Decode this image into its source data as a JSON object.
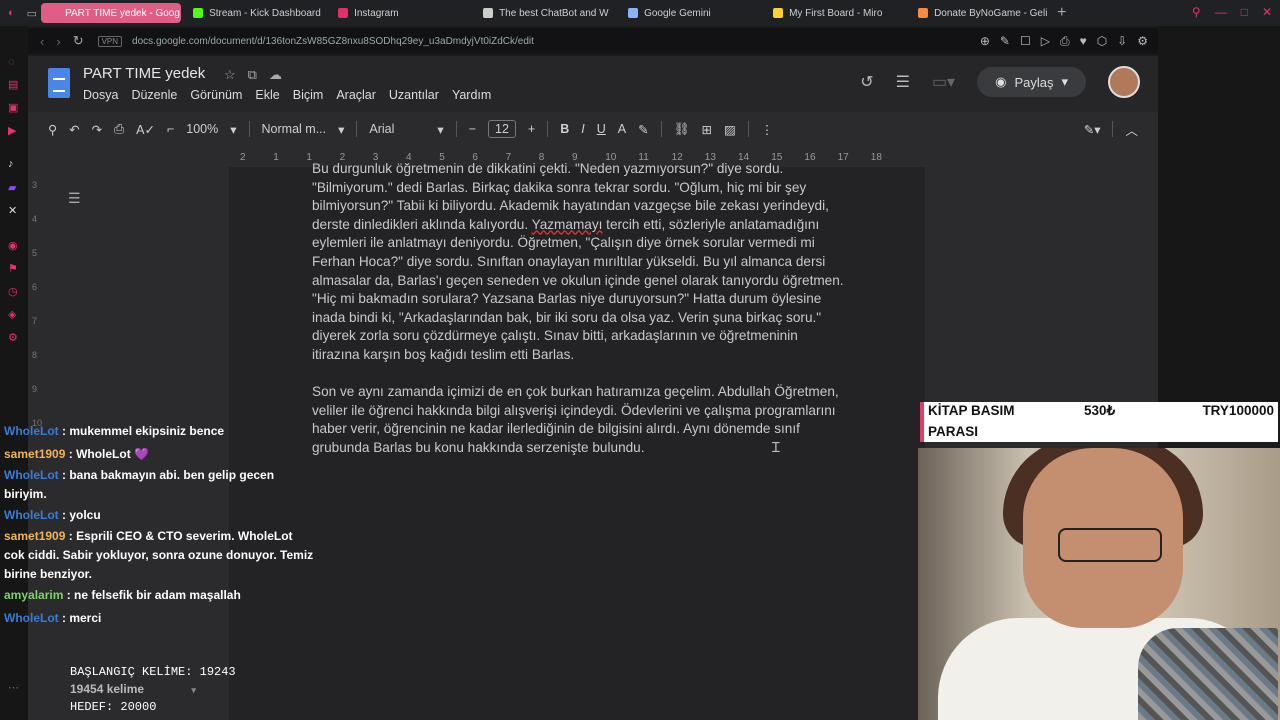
{
  "browser": {
    "tabs": [
      {
        "label": "PART TIME yedek - Goog",
        "color": "#e05d86",
        "active": true
      },
      {
        "label": "Stream - Kick Dashboard",
        "color": "#53fc18",
        "active": false
      },
      {
        "label": "Instagram",
        "color": "#e1306c",
        "active": false
      },
      {
        "label": "The best ChatBot and W",
        "color": "#cccccc",
        "active": false
      },
      {
        "label": "Google Gemini",
        "color": "#8ab4f8",
        "active": false
      },
      {
        "label": "My First Board - Miro",
        "color": "#ffd02f",
        "active": false
      },
      {
        "label": "Donate ByNoGame - Geli",
        "color": "#ff8a3d",
        "active": false
      }
    ],
    "url": "docs.google.com/document/d/136tonZsW85GZ8nxu8SODhq29ey_u3aDmdyjVt0iZdCk/edit"
  },
  "docs": {
    "title": "PART TIME yedek",
    "menus": [
      "Dosya",
      "Düzenle",
      "Görünüm",
      "Ekle",
      "Biçim",
      "Araçlar",
      "Uzantılar",
      "Yardım"
    ],
    "share_label": "Paylaş",
    "zoom": "100%",
    "style": "Normal m...",
    "font": "Arial",
    "font_size": "12",
    "ruler_marks": [
      "2",
      "1",
      "1",
      "2",
      "3",
      "4",
      "5",
      "6",
      "7",
      "8",
      "9",
      "10",
      "11",
      "12",
      "13",
      "14",
      "15",
      "16",
      "17",
      "18"
    ],
    "paragraphs": [
      "Bu durgunluk öğretmenin de dikkatini çekti. \"Neden yazmıyorsun?\" diye sordu. \"Bilmiyorum.\" dedi Barlas. Birkaç dakika sonra tekrar sordu. \"Oğlum, hiç mi bir şey bilmiyorsun?\" Tabii ki biliyordu. Akademik hayatından vazgeçse bile zekası yerindeydi, derste dinledikleri aklında kalıyordu. ",
      "Son ve aynı zamanda içimizi de en çok burkan hatıramıza geçelim. Abdullah Öğretmen, veliler ile öğrenci hakkında bilgi alışverişi içindeydi. Ödevlerini ve çalışma programlarını haber verir, öğrencinin ne kadar ilerlediğinin de bilgisini alırdı. Aynı dönemde sınıf grubunda Barlas bu konu hakkında serzenişte bulundu."
    ],
    "para1_underlined": "Yazmamayı",
    "para1_rest": " tercih etti, sözleriyle anlatamadığını eylemleri ile anlatmayı deniyordu. Öğretmen, \"Çalışın diye örnek sorular vermedi mi Ferhan Hoca?\" diye sordu. Sınıftan onaylayan mırıltılar yükseldi. Bu yıl almanca dersi almasalar da, Barlas'ı geçen seneden ve okulun içinde genel olarak tanıyordu öğretmen. \"Hiç mi bakmadın sorulara? Yazsana Barlas niye duruyorsun?\" Hatta durum öylesine inada bindi ki, \"Arkadaşlarından bak, bir iki soru da olsa yaz. Verin şuna birkaç soru.\" diyerek zorla soru çözdürmeye çalıştı. Sınav bitti, arkadaşlarının ve öğretmeninin itirazına karşın boş kağıdı teslim etti Barlas."
  },
  "overlay": {
    "goal_label": "KİTAP BASIM",
    "goal_label2": "PARASI",
    "goal_current": "530₺",
    "goal_target": "TRY100000",
    "chat": [
      {
        "user": "WholeLot",
        "color": "#3b7bd8",
        "text": "mukemmel ekipsiniz bence"
      },
      {
        "user": "samet1909",
        "color": "#f0b45a",
        "text": "WholeLot 💜"
      },
      {
        "user": "WholeLot",
        "color": "#3b7bd8",
        "text": "bana bakmayın abi. ben gelip gecen biriyim."
      },
      {
        "user": "WholeLot",
        "color": "#3b7bd8",
        "text": "yolcu"
      },
      {
        "user": "samet1909",
        "color": "#f0b45a",
        "text": "Esprili CEO & CTO severim. WholeLot cok ciddi. Sabir yokluyor, sonra ozune donuyor. Temiz birine benziyor."
      },
      {
        "user": "amyalarim",
        "color": "#7bd36a",
        "text": "ne felsefik bir adam maşallah"
      },
      {
        "user": "WholeLot",
        "color": "#3b7bd8",
        "text": "merci"
      }
    ],
    "start_words_label": "BAŞLANGIÇ KELİME: 19243",
    "word_count": "19454 kelime",
    "target_label": "HEDEF: 20000"
  }
}
